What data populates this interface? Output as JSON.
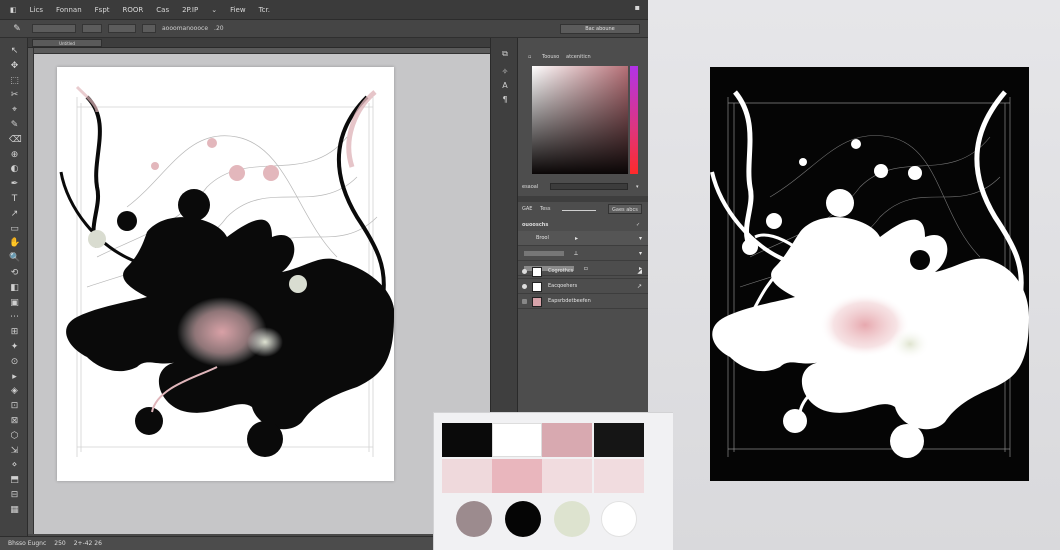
{
  "menu": [
    "Lics",
    "Fonnan",
    "Fspt",
    "ROOR",
    "Cas",
    "2P.IP",
    "Fiew",
    "Tcr."
  ],
  "options": {
    "field_text": "aooomanoooce",
    "value": ".20",
    "right_field": "Bac aboune"
  },
  "document_tab": "Untitled",
  "status": {
    "left": "Bhsso Eugnc",
    "zoom": "250",
    "info": "2+-42 26"
  },
  "color_panel": {
    "tabs": [
      "Toouso",
      "atceniticn"
    ],
    "hex_label": "esaoal"
  },
  "layers_panel": {
    "header": "GAE",
    "header_tabs": [
      "Tess",
      "Gaes abcs"
    ],
    "title": "ouooschs",
    "mode": "Brool",
    "layers": [
      {
        "name": "Cogrothcs",
        "thumb": "#ffffff"
      },
      {
        "name": "Eacqoehers",
        "thumb": "#ffffff"
      },
      {
        "name": "Eapsrbdetbeefen",
        "thumb": "#d7a3aa"
      }
    ]
  },
  "palette": {
    "swatches_row1": [
      "#0a0a0a",
      "#ffffff",
      "#d8a9b0",
      "#151515"
    ],
    "swatches_row2": [
      "#efd9dc",
      "#e9b6bd",
      "#f1dcdf",
      "#f1dcdf"
    ],
    "circles": [
      "#9c8b8e",
      "#050505",
      "#dde3cf",
      "#ffffff"
    ]
  },
  "colors": {
    "accent_pink": "#e3a8ae",
    "gradient_hue": "#e0357a"
  }
}
